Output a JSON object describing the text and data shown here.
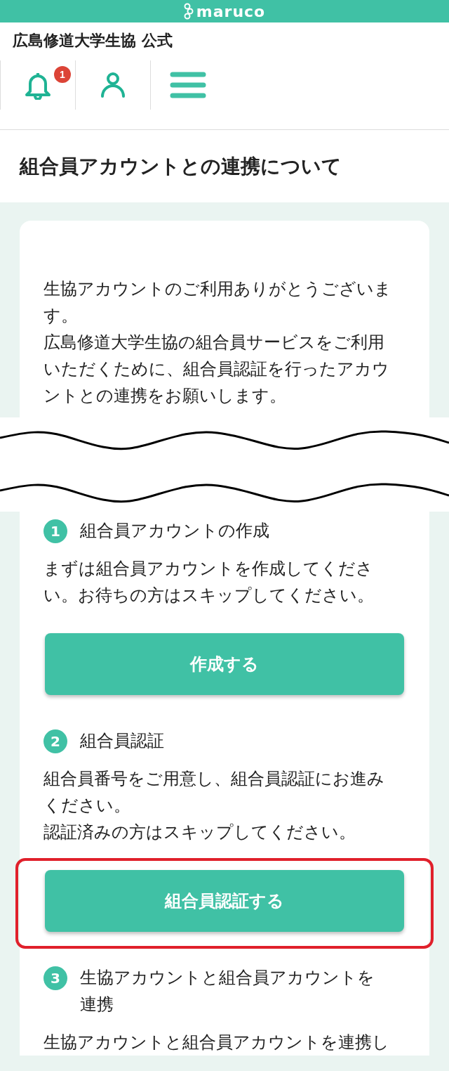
{
  "brand_bar": {
    "logo_text": "maruco"
  },
  "header": {
    "title": "広島修道大学生協 公式",
    "notification_count": "1"
  },
  "page_title": "組合員アカウントとの連携について",
  "intro": [
    "生協アカウントのご利用ありがとうございます。",
    "広島修道大学生協の組合員サービスをご利用いただくために、組合員認証を行ったアカウントとの連携をお願いします。"
  ],
  "steps": [
    {
      "number": "1",
      "title": "組合員アカウントの作成",
      "description": [
        "まずは組合員アカウントを作成してください。お待ちの方はスキップしてください。"
      ],
      "button": "作成する",
      "highlighted": false
    },
    {
      "number": "2",
      "title": "組合員認証",
      "description": [
        "組合員番号をご用意し、組合員認証にお進みください。",
        "認証済みの方はスキップしてください。"
      ],
      "button": "組合員認証する",
      "highlighted": true
    },
    {
      "number": "3",
      "title": "生協アカウントと組合員アカウントを連携",
      "description": [
        "生協アカウントと組合員アカウントを連携し"
      ]
    }
  ]
}
